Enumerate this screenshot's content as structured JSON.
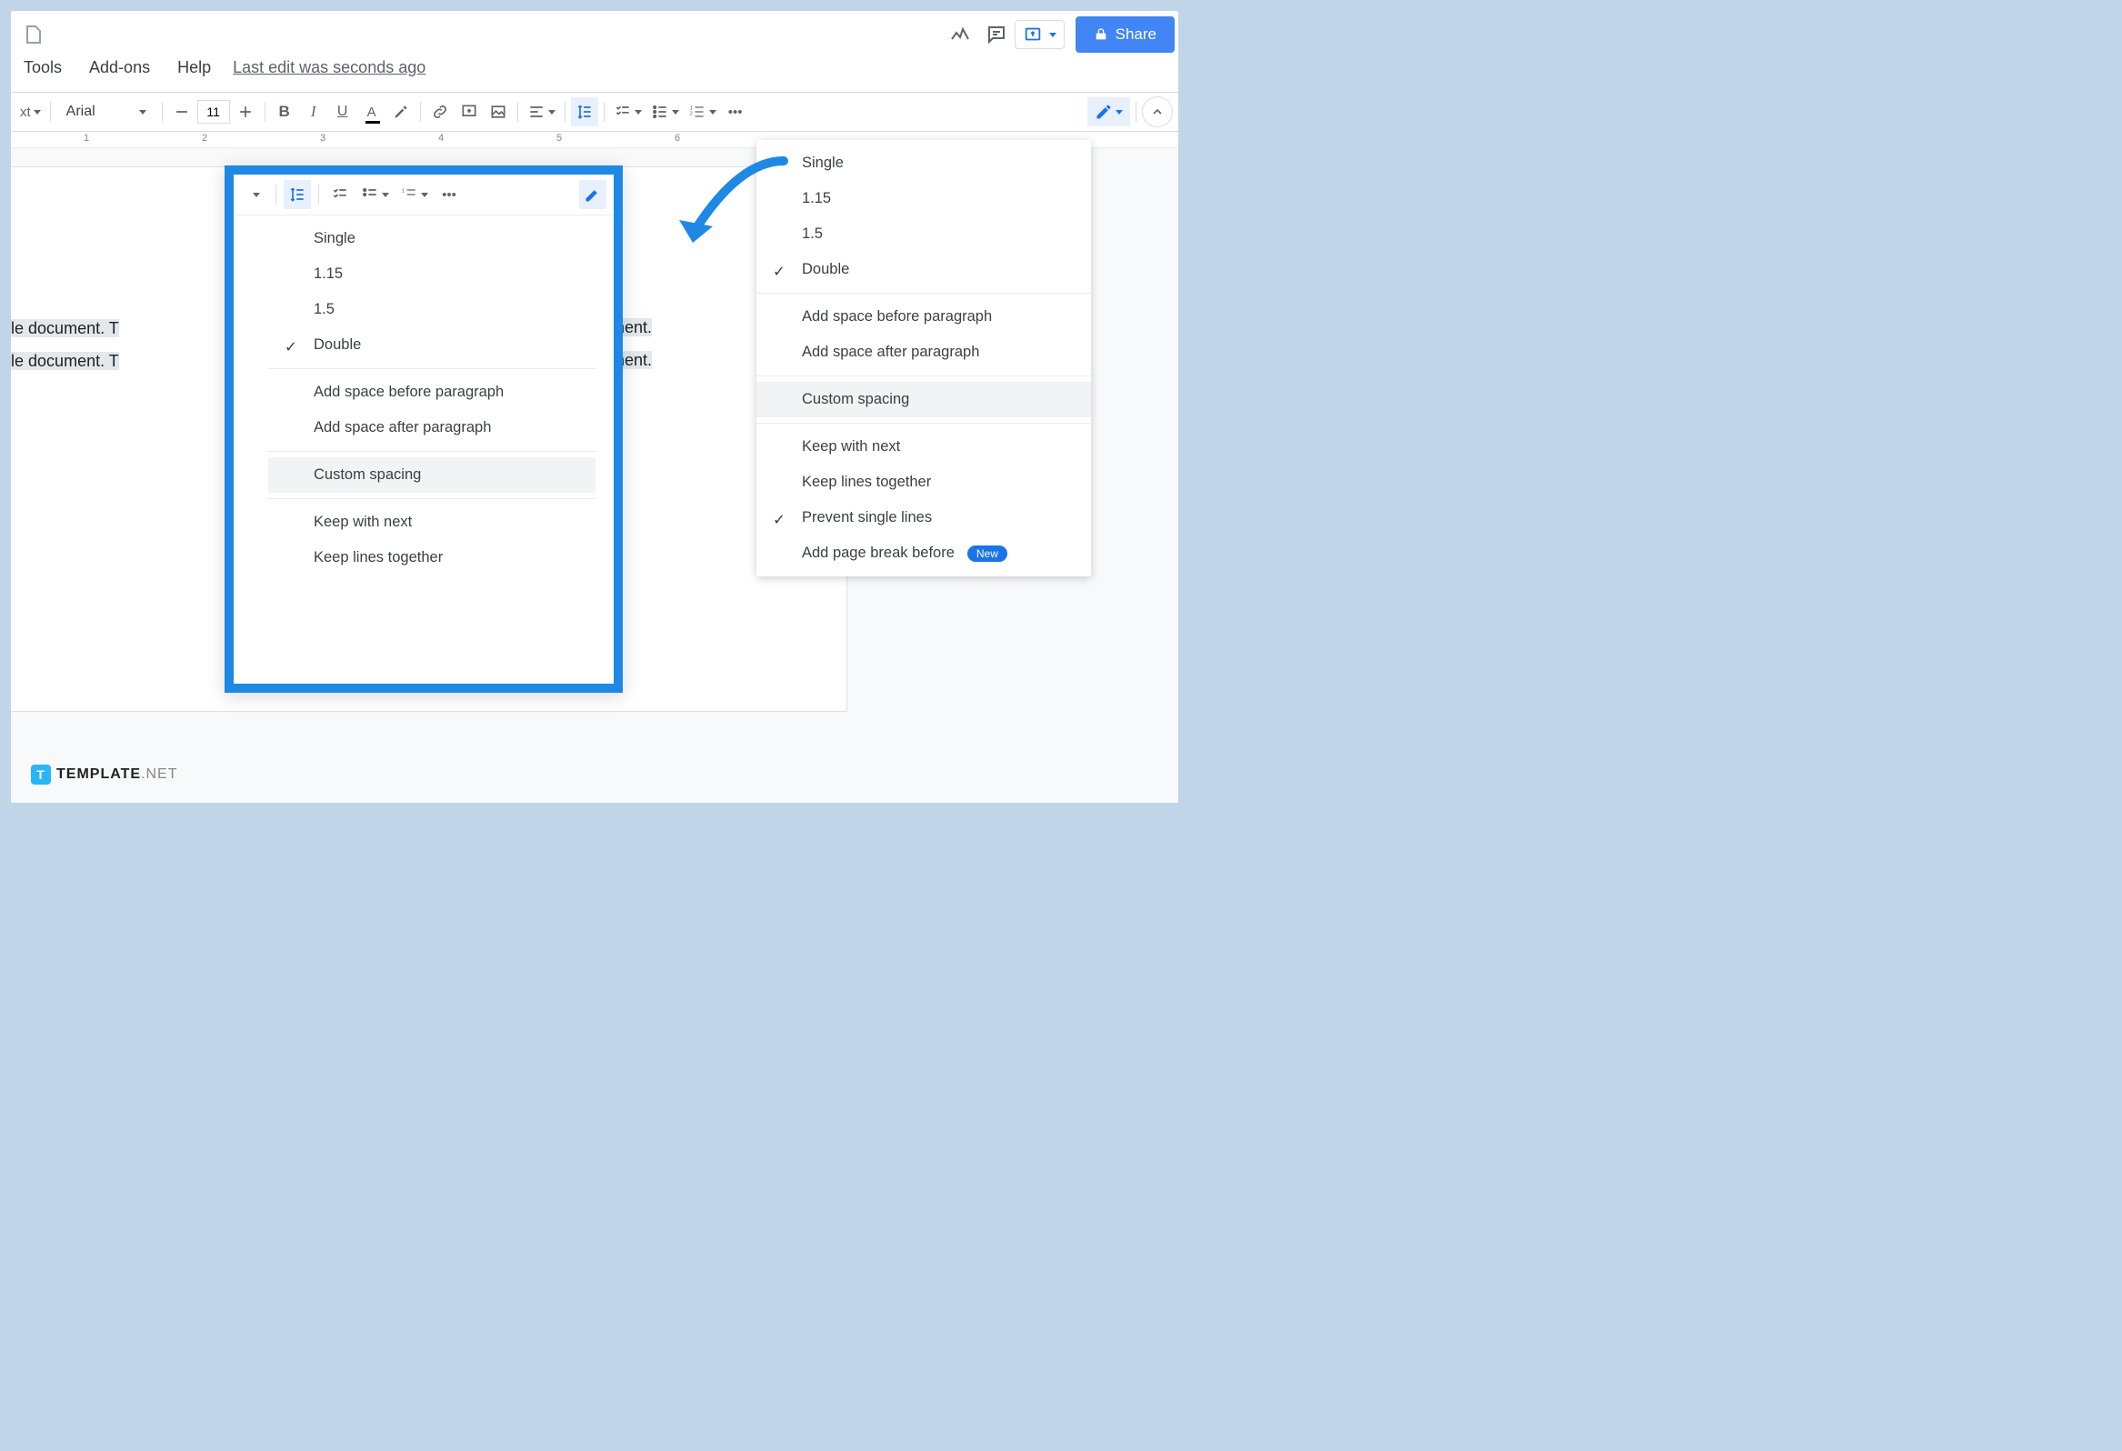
{
  "header": {
    "menus": {
      "tools": "Tools",
      "addons": "Add-ons",
      "help": "Help"
    },
    "edit_status": "Last edit was seconds ago",
    "share": "Share"
  },
  "toolbar": {
    "style_label": "xt",
    "font": "Arial",
    "size": "11"
  },
  "ruler": {
    "marks": [
      "1",
      "2",
      "3",
      "4",
      "5",
      "6"
    ]
  },
  "document": {
    "line1_left": " a sample document. T",
    "line1_right": "ument.",
    "line2_left": " a sample document. T",
    "line2_right": "ument."
  },
  "spacing_menu": {
    "single": "Single",
    "v115": "1.15",
    "v15": "1.5",
    "double": "Double",
    "before": "Add space before paragraph",
    "after": "Add space after paragraph",
    "custom": "Custom spacing",
    "keepnext": "Keep with next",
    "keeplines": "Keep lines together",
    "prevent": "Prevent single lines",
    "pagebreak": "Add page break before",
    "new": "New"
  },
  "watermark": {
    "brand": "TEMPLATE",
    "suffix": ".NET",
    "logo": "T"
  }
}
